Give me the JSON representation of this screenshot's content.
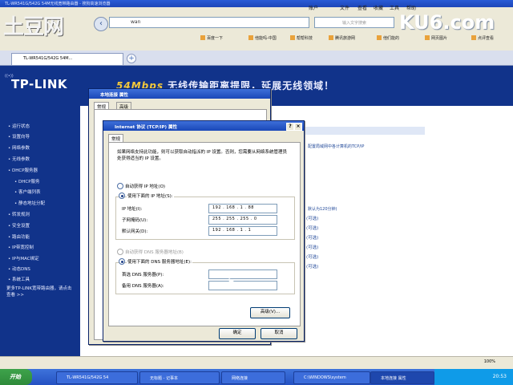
{
  "browser": {
    "window_title": "TL-WR541G/542G 54M无线宽带路由器 - 搜狗高速浏览器",
    "menus": [
      "账户",
      "文件",
      "查看",
      "收藏",
      "工具",
      "帮助"
    ],
    "address": "wan",
    "search_placeholder": "输入文字搜索",
    "favorites": [
      "百度一下",
      "他能吗-中国",
      "帮帮科技",
      "腾讯旅游网",
      "他们能的",
      "网页图片",
      "点评查看"
    ],
    "tab_label": "TL-WR541G/542G 54M...",
    "watermark_left": "土豆网",
    "watermark_right": "KU6.com"
  },
  "router": {
    "brand": "TP-LINK",
    "slogan_speed": "54Mbps",
    "slogan": "无线传输距离提限，延展无线领域！",
    "nav": [
      {
        "label": "• 运行状态",
        "sub": false
      },
      {
        "label": "• 设置向导",
        "sub": false
      },
      {
        "label": "• 网络参数",
        "sub": false
      },
      {
        "label": "• 无线参数",
        "sub": false
      },
      {
        "label": "• DHCP服务器",
        "sub": false
      },
      {
        "label": "• DHCP服务",
        "sub": true
      },
      {
        "label": "• 客户端列表",
        "sub": true
      },
      {
        "label": "• 静态地址分配",
        "sub": true
      },
      {
        "label": "• 转发规则",
        "sub": false
      },
      {
        "label": "• 安全设置",
        "sub": false
      },
      {
        "label": "• 路由功能",
        "sub": false
      },
      {
        "label": "• IP带宽控制",
        "sub": false
      },
      {
        "label": "• IP与MAC绑定",
        "sub": false
      },
      {
        "label": "• 动态DNS",
        "sub": false
      },
      {
        "label": "• 系统工具",
        "sub": false
      }
    ],
    "side_help": "更多TP-LINK宽带路由器，请点击查看 >>",
    "help_line1": "配置局域网中各计算机的TCP/IP",
    "help_line2": "",
    "option_links": [
      "(可选)",
      "(可选)",
      "(可选)",
      "(可选)",
      "(可选)",
      "(可选)"
    ],
    "help_line3": "默认为120分钟)"
  },
  "dialog_back": {
    "title": "本地连接 属性",
    "tabs": [
      "常规",
      "高级"
    ]
  },
  "dialog_front": {
    "title": "Internet 协议 (TCP/IP) 属性",
    "tab": "常规",
    "intro": "如果网络支持此功能，则可以获取自动指派的 IP 设置。否则，您需要从网络系统管理员处获得适当的 IP 设置。",
    "radio_auto_ip": "自动获得 IP 地址(O)",
    "radio_manual_ip": "使用下面的 IP 地址(S):",
    "label_ip": "IP 地址(I):",
    "value_ip": "192 . 168 .  1  . 88",
    "label_mask": "子网掩码(U):",
    "value_mask": "255 . 255 . 255 .  0",
    "label_gateway": "默认网关(D):",
    "value_gateway": "192 . 168 .  1  .  1",
    "radio_auto_dns": "自动获得 DNS 服务器地址(B)",
    "radio_manual_dns": "使用下面的 DNS 服务器地址(E):",
    "label_dns1": "首选 DNS 服务器(P):",
    "label_dns2": "备用 DNS 服务器(A):",
    "advanced_button": "高级(V)...",
    "ok_button": "确定",
    "cancel_button": "取消"
  },
  "taskbar": {
    "start": "开始",
    "items": [
      "TL-WR541G/542G 54",
      "无标题 - 记事本",
      "网络连接",
      "C:\\WINDOWS\\system",
      "本地连接 属性"
    ],
    "status_zoom": "100%",
    "clock": "20:53"
  }
}
